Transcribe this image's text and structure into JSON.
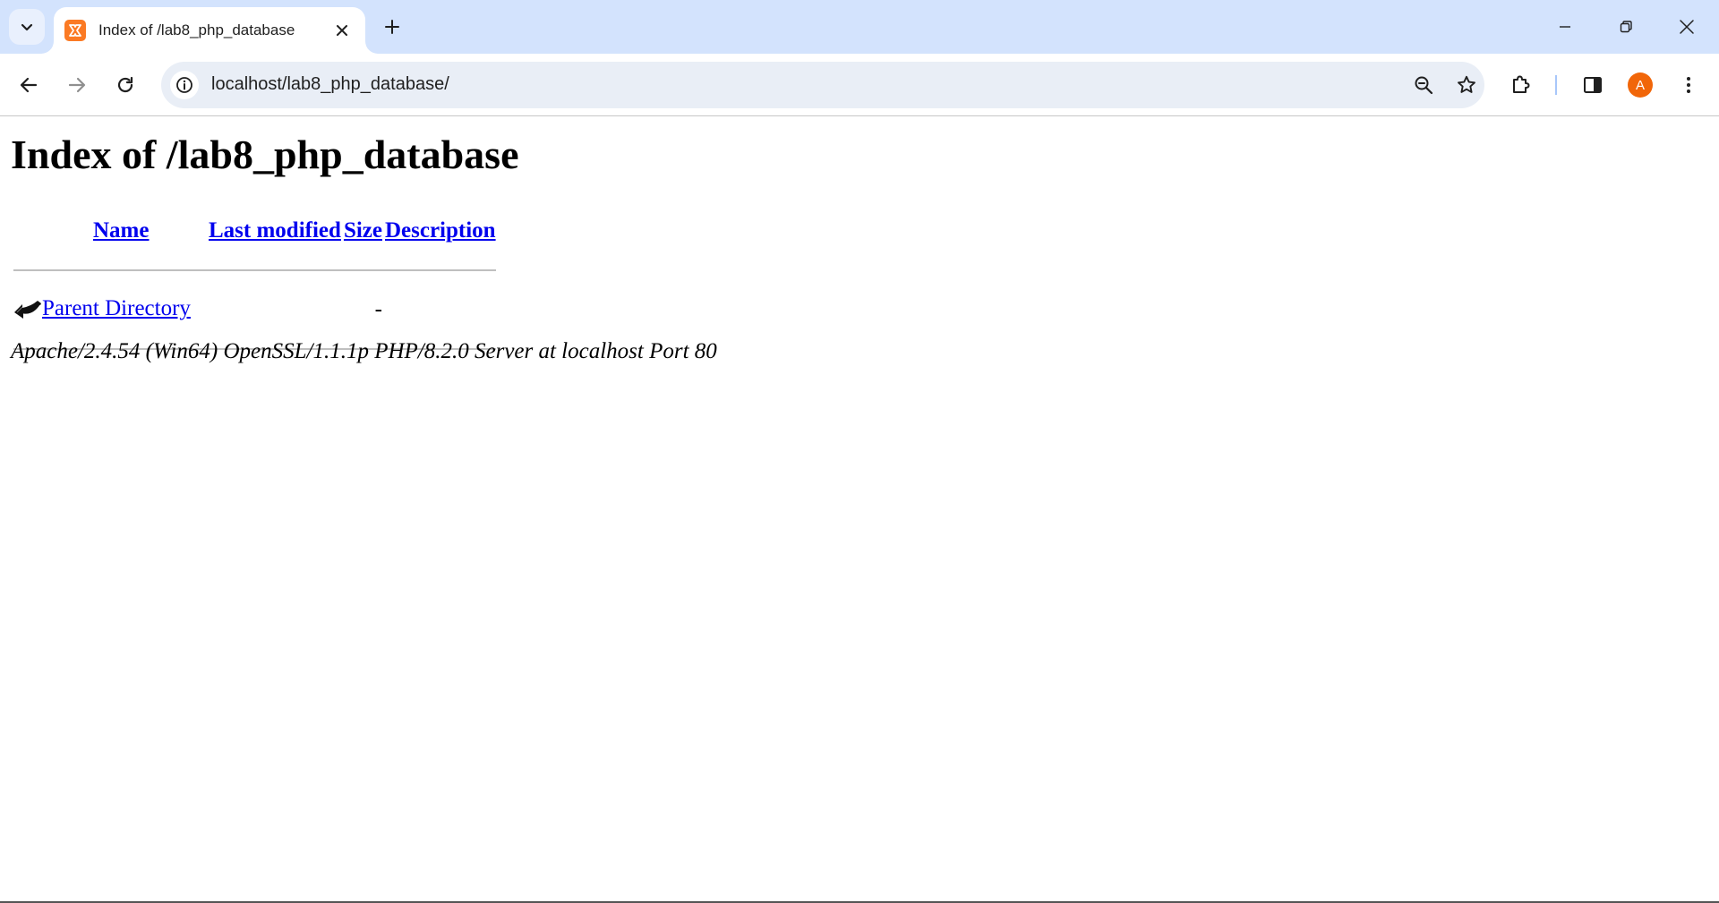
{
  "browser": {
    "tab": {
      "title": "Index of /lab8_php_database"
    },
    "address_bar": {
      "url": "localhost/lab8_php_database/"
    },
    "profile": {
      "initial": "A"
    },
    "colors": {
      "chrome_bg": "#d3e3fd",
      "favicon": "#fb7a24",
      "avatar": "#f16609"
    }
  },
  "page": {
    "title": "Index of /lab8_php_database",
    "columns": {
      "name": "Name",
      "last_modified": "Last modified",
      "size": "Size",
      "description": "Description"
    },
    "rows": [
      {
        "icon": "back-arrow-icon",
        "name": "Parent Directory",
        "last_modified": "",
        "size": "-",
        "description": ""
      }
    ],
    "server_signature": "Apache/2.4.54 (Win64) OpenSSL/1.1.1p PHP/8.2.0 Server at localhost Port 80",
    "colors": {
      "link": "#0000ee",
      "rule": "#bfbfbf"
    }
  }
}
